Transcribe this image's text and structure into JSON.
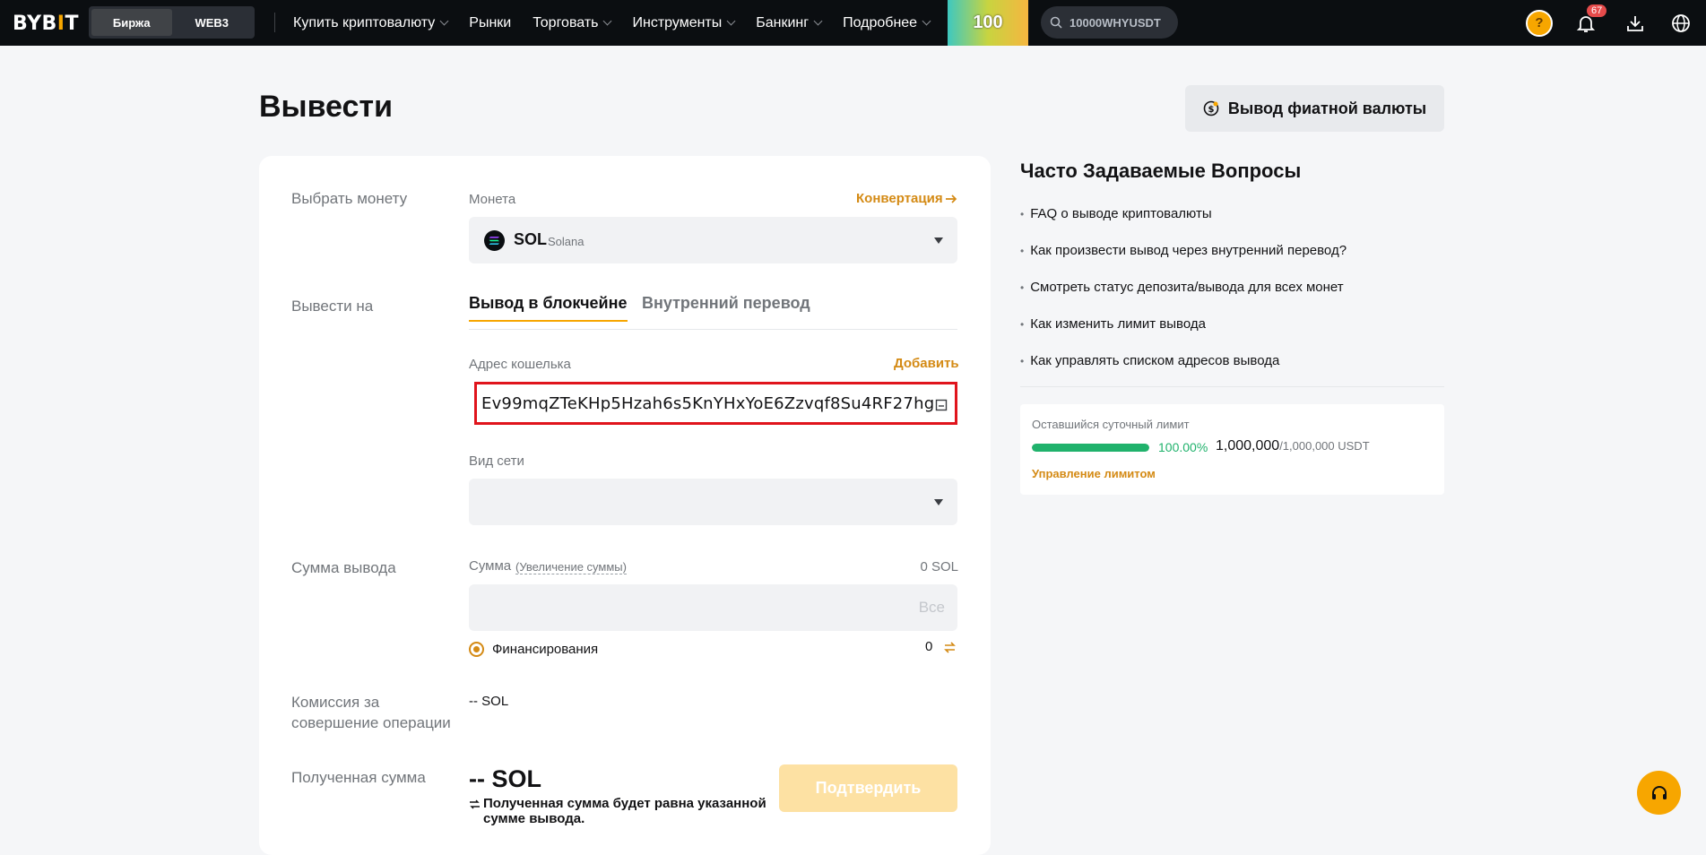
{
  "header": {
    "logo_text": "BYBIT",
    "mode_tabs": [
      "Биржа",
      "WEB3"
    ],
    "menu": [
      {
        "label": "Купить криптовалюту",
        "has_dropdown": true
      },
      {
        "label": "Рынки",
        "has_dropdown": false
      },
      {
        "label": "Торговать",
        "has_dropdown": true
      },
      {
        "label": "Инструменты",
        "has_dropdown": true
      },
      {
        "label": "Банкинг",
        "has_dropdown": true
      },
      {
        "label": "Подробнее",
        "has_dropdown": true
      }
    ],
    "promo_text": "100",
    "search_value": "10000WHYUSDT",
    "notification_count": "67"
  },
  "page": {
    "title": "Вывести",
    "fiat_button": "Вывод фиатной валюты"
  },
  "form": {
    "select_coin_label": "Выбрать монету",
    "coin_field_label": "Монета",
    "convert_link": "Конвертация",
    "coin_symbol": "SOL",
    "coin_name": "Solana",
    "withdraw_to_label": "Вывести на",
    "tabs": [
      "Вывод в блокчейне",
      "Внутренний перевод"
    ],
    "wallet_label": "Адрес кошелька",
    "add_link": "Добавить",
    "wallet_address": "Ev99mqZTeKHp5Hzah6s5KnYHxYoE6Zzvqf8Su4RF27hg",
    "network_label": "Вид сети",
    "amount_row_label": "Сумма вывода",
    "amount_label": "Сумма",
    "increase_link": "(Увеличение суммы)",
    "available": "0 SOL",
    "all_button": "Все",
    "funding_label": "Финансирования",
    "funding_value": "0",
    "fee_label": "Комиссия за совершение операции",
    "fee_value": "-- SOL",
    "received_label": "Полученная сумма",
    "received_value": "-- SOL",
    "received_note": "Полученная сумма будет равна указанной сумме вывода.",
    "confirm_button": "Подтвердить"
  },
  "faq": {
    "title": "Часто Задаваемые Вопросы",
    "items": [
      "FAQ о выводе криптовалюты",
      "Как произвести вывод через внутренний перевод?",
      "Смотреть статус депозита/вывода для всех монет",
      "Как изменить лимит вывода",
      "Как управлять списком адресов вывода"
    ]
  },
  "limit": {
    "title": "Оставшийся суточный лимит",
    "percent": "100.00%",
    "progress_fraction": 1.0,
    "amount": "1,000,000",
    "total": "/1,000,000 USDT",
    "manage_link": "Управление лимитом"
  },
  "colors": {
    "accent": "#f7a600",
    "link": "#d48a14",
    "success": "#20b26c",
    "error_border": "#e0141c"
  }
}
